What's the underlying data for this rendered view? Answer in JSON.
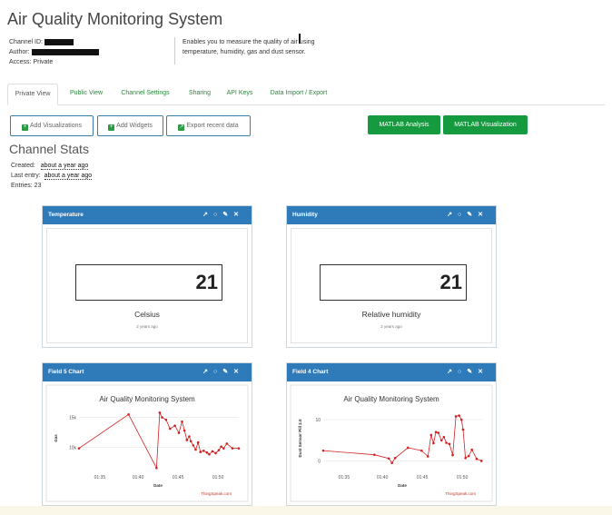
{
  "header": {
    "title": "Air Quality Monitoring System",
    "channel_id_label": "Channel ID:",
    "author_label": "Author:",
    "access": "Access: Private",
    "description": "Enables you to measure the quality of air using temperature, humidity, gas and dust sensor."
  },
  "tabs": [
    {
      "label": "Private View",
      "active": true
    },
    {
      "label": "Public View"
    },
    {
      "label": "Channel Settings"
    },
    {
      "label": "Sharing"
    },
    {
      "label": "API Keys"
    },
    {
      "label": "Data Import / Export"
    }
  ],
  "buttons": {
    "add_visualizations": "Add Visualizations",
    "add_widgets": "Add Widgets",
    "export_recent": "Export recent data",
    "matlab_analysis": "MATLAB Analysis",
    "matlab_visualization": "MATLAB Visualization"
  },
  "stats": {
    "title": "Channel Stats",
    "created_label": "Created:",
    "created_value": "about a year ago",
    "last_entry_label": "Last entry:",
    "last_entry_value": "about a year ago",
    "entries": "Entries: 23"
  },
  "widgets": {
    "temperature": {
      "title": "Temperature",
      "value": "21",
      "unit": "Celsius",
      "ago": "2 years ago"
    },
    "humidity": {
      "title": "Humidity",
      "value": "21",
      "unit": "Relative humidity",
      "ago": "2 years ago"
    }
  },
  "colors": {
    "header_blue": "#2f7ab9",
    "green": "#159a3f",
    "line_red": "#d42020",
    "link_green": "#2a8a3a"
  },
  "chart_data": [
    {
      "panel": "Field 5 Chart",
      "type": "line",
      "title": "Air Quality Monitoring System",
      "xlabel": "Date",
      "ylabel": "Gas",
      "credit": "ThingSpeak.com",
      "xticks": [
        "01:35",
        "01:40",
        "01:45",
        "01:50"
      ],
      "yticks": [
        "10k",
        "15k"
      ],
      "ylim": [
        7000,
        16000
      ],
      "x": [
        0,
        0.31,
        0.485,
        0.505,
        0.52,
        0.545,
        0.57,
        0.6,
        0.625,
        0.645,
        0.66,
        0.675,
        0.69,
        0.7,
        0.715,
        0.73,
        0.745,
        0.76,
        0.78,
        0.8,
        0.815,
        0.835,
        0.855,
        0.875,
        0.89,
        0.905,
        0.925,
        0.96,
        1.0
      ],
      "values": [
        9800,
        15500,
        6500,
        15800,
        15000,
        14600,
        13100,
        13600,
        12400,
        14300,
        12800,
        11200,
        11800,
        11000,
        10300,
        9600,
        10800,
        9200,
        9400,
        9100,
        8800,
        9300,
        9000,
        9500,
        10100,
        9800,
        10600,
        9800,
        9800
      ]
    },
    {
      "panel": "Field 4 Chart",
      "type": "line",
      "title": "Air Quality Monitoring System",
      "xlabel": "Date",
      "ylabel": "Dust Sensor Pill 2.5",
      "credit": "ThingSpeak.com",
      "xticks": [
        "01:35",
        "01:40",
        "01:45",
        "01:50"
      ],
      "yticks": [
        "0",
        "10"
      ],
      "ylim": [
        -1,
        12
      ],
      "x": [
        0,
        0.32,
        0.41,
        0.43,
        0.45,
        0.53,
        0.615,
        0.655,
        0.675,
        0.69,
        0.705,
        0.72,
        0.74,
        0.755,
        0.77,
        0.79,
        0.81,
        0.83,
        0.85,
        0.865,
        0.875,
        0.89,
        0.91,
        0.93,
        0.96,
        0.99
      ],
      "values": [
        2.5,
        1.5,
        0.6,
        -0.5,
        0.7,
        3.2,
        2.5,
        1.1,
        6.3,
        4.3,
        7.0,
        6.8,
        5.0,
        5.8,
        4.4,
        4.1,
        1.4,
        10.8,
        11.0,
        10.0,
        7.6,
        0.7,
        1.2,
        2.7,
        0.5,
        0.0
      ]
    }
  ]
}
